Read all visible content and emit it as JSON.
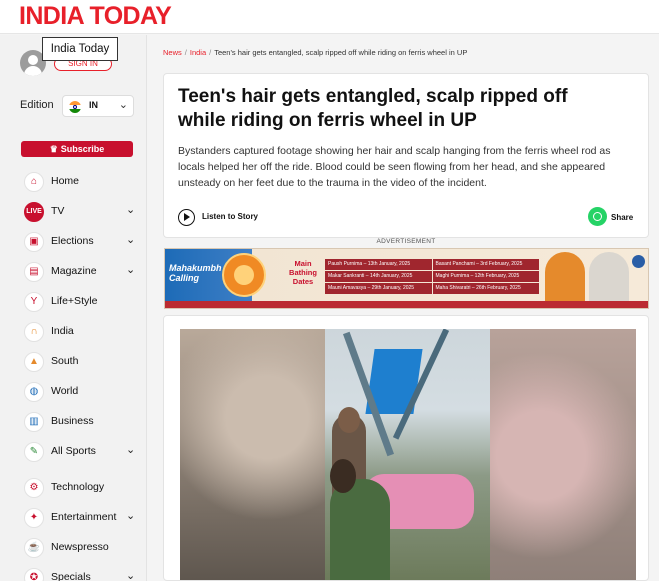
{
  "header": {
    "logo_text": "INDIA TODAY",
    "brand_color": "#e8202a"
  },
  "account": {
    "tooltip": "India Today",
    "signin_label": "SIGN IN",
    "avatar_icon": "user-icon"
  },
  "edition": {
    "label": "Edition",
    "value": "IN",
    "flag_icon": "india-flag-icon"
  },
  "subscribe": {
    "label": "Subscribe",
    "icon": "crown-icon"
  },
  "nav": {
    "items": [
      {
        "label": "Home",
        "icon": "home-icon",
        "expandable": false
      },
      {
        "label": "TV",
        "icon": "live-tv-icon",
        "expandable": true
      },
      {
        "label": "Elections",
        "icon": "ballot-icon",
        "expandable": true
      },
      {
        "label": "Magazine",
        "icon": "magazine-icon",
        "expandable": true
      },
      {
        "label": "Life+Style",
        "icon": "cocktail-icon",
        "expandable": false
      },
      {
        "label": "India",
        "icon": "india-gate-icon",
        "expandable": false
      },
      {
        "label": "South",
        "icon": "temple-icon",
        "expandable": false
      },
      {
        "label": "World",
        "icon": "globe-icon",
        "expandable": false
      },
      {
        "label": "Business",
        "icon": "chart-icon",
        "expandable": false
      },
      {
        "label": "All Sports",
        "icon": "sports-icon",
        "expandable": true
      },
      {
        "label": "Technology",
        "icon": "chip-icon",
        "expandable": false
      },
      {
        "label": "Entertainment",
        "icon": "film-icon",
        "expandable": true
      },
      {
        "label": "Newspresso",
        "icon": "coffee-icon",
        "expandable": false
      },
      {
        "label": "Specials",
        "icon": "star-icon",
        "expandable": true
      }
    ]
  },
  "breadcrumb": {
    "items": [
      "News",
      "India",
      "Teen's hair gets entangled, scalp ripped off while riding on ferris wheel in UP"
    ]
  },
  "article": {
    "headline": "Teen's hair gets entangled, scalp ripped off while riding on ferris wheel in UP",
    "summary": "Bystanders captured footage showing her hair and scalp hanging from the ferris wheel rod as locals helped her off the ride. Blood could be seen flowing from her head, and she appeared unsteady on her feet due to the trauma in the video of the incident.",
    "listen_label": "Listen to Story",
    "share_label": "Share"
  },
  "ad": {
    "label": "ADVERTISEMENT",
    "title": "Mahakumbh Calling",
    "mid_text": "Main Bathing Dates",
    "dates": [
      [
        "Paush Purnima – 13th January, 2025",
        "Basant Panchami – 3rd February, 2025"
      ],
      [
        "Makar Sankranti – 14th January, 2025",
        "Maghi Purnima – 12th February, 2025"
      ],
      [
        "Mauni Amavasya – 29th January, 2025",
        "Maha Shivaratri – 26th February, 2025"
      ]
    ]
  }
}
